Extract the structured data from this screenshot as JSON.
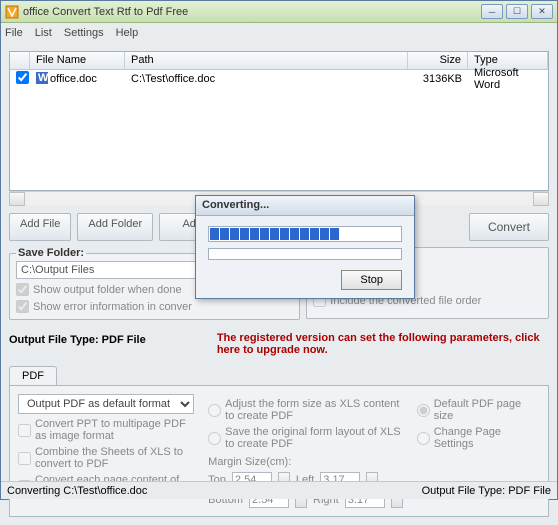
{
  "app": {
    "title": "office Convert Text Rtf to Pdf Free"
  },
  "menu": {
    "file": "File",
    "list": "List",
    "settings": "Settings",
    "help": "Help"
  },
  "filelist": {
    "headers": {
      "name": "File Name",
      "path": "Path",
      "size": "Size",
      "type": "Type"
    },
    "rows": [
      {
        "checked": true,
        "name": "office.doc",
        "path": "C:\\Test\\office.doc",
        "size": "3136KB",
        "type": "Microsoft Word"
      }
    ]
  },
  "buttons": {
    "addfile": "Add File",
    "addfolder": "Add Folder",
    "ad": "Ad",
    "convert": "Convert"
  },
  "save": {
    "legend": "Save Folder:",
    "path": "C:\\Output Files",
    "opt1": "Show output folder when done",
    "opt2": "Show error information in conver",
    "opt3": "Include the converted file order"
  },
  "output": {
    "label": "Output File Type:  PDF File",
    "warn": "The registered version can set the following parameters, click here to upgrade now."
  },
  "tabs": {
    "pdf": "PDF"
  },
  "pdf": {
    "format": "Output PDF as default format",
    "c1": "Convert PPT to multipage PDF as image format",
    "c2": "Combine the Sheets of XLS to convert to PDF",
    "c3": "Convert each page content of DOC/RTF to single PDF",
    "r1": "Adjust the form size as XLS content to create PDF",
    "r2": "Save the original form layout of XLS to create PDF",
    "r3": "Default PDF page size",
    "r4": "Change Page Settings",
    "margin_label": "Margin Size(cm):",
    "top": "Top",
    "left": "Left",
    "bottom": "Bottom",
    "right": "Right",
    "v_top": "2.54",
    "v_left": "3.17",
    "v_bottom": "2.54",
    "v_right": "3.17"
  },
  "status": {
    "left": "Converting  C:\\Test\\office.doc",
    "right": "Output File Type:  PDF File"
  },
  "dialog": {
    "title": "Converting...",
    "stop": "Stop",
    "progress_blocks": 13
  }
}
